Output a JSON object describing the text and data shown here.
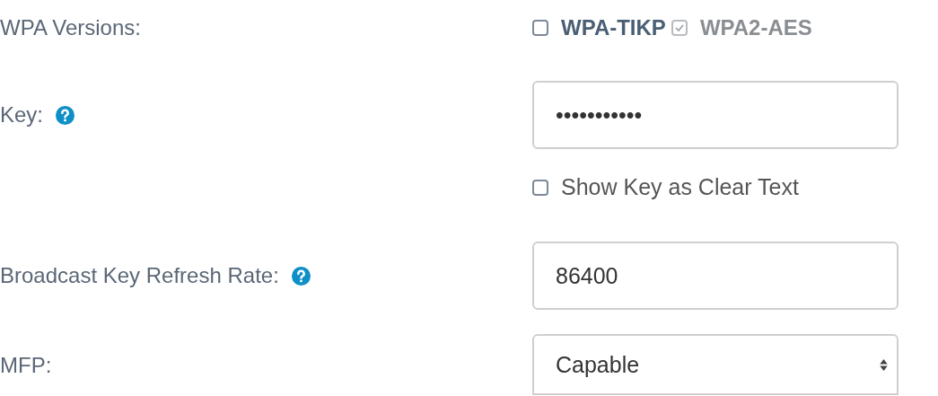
{
  "rows": [
    {
      "kind": "checkboxes",
      "label": "WPA Versions:",
      "options": [
        {
          "label": "WPA-TIKP",
          "checked": false,
          "disabled": false
        },
        {
          "label": "WPA2-AES",
          "checked": true,
          "disabled": true
        }
      ]
    },
    {
      "kind": "field",
      "label": "Key:",
      "help": true,
      "value": "•••••••••••",
      "extra": {
        "label": "Show Key as Clear Text",
        "checked": false
      }
    },
    {
      "kind": "field",
      "label": "Broadcast Key Refresh Rate:",
      "help": true,
      "value": "86400"
    },
    {
      "kind": "select",
      "label": "MFP:",
      "value": "Capable"
    }
  ]
}
